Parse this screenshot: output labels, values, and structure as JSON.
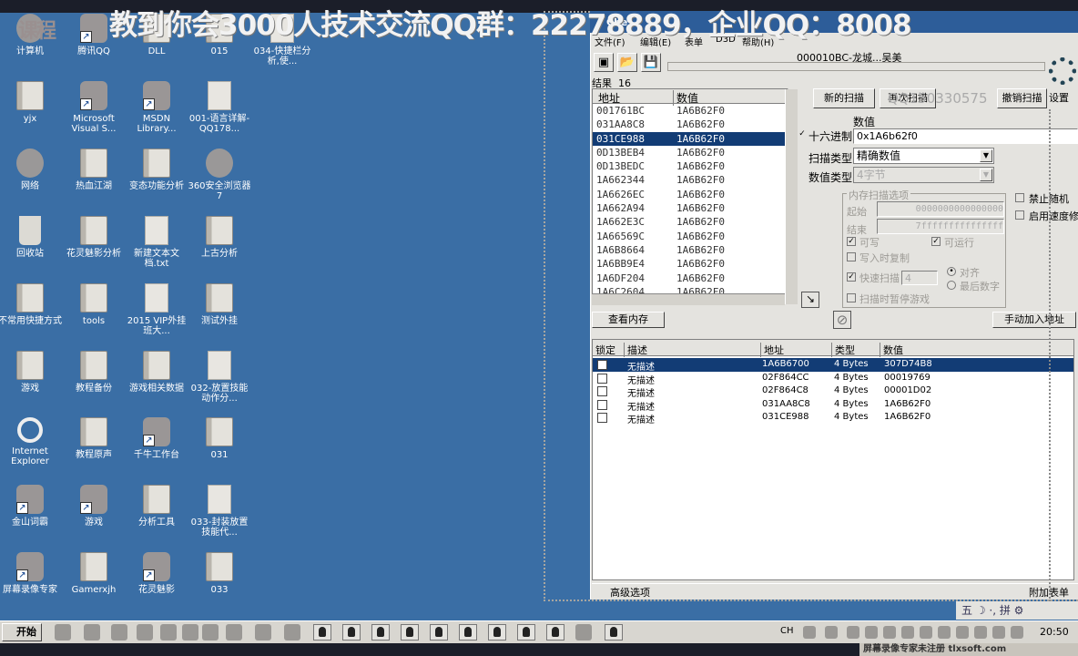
{
  "watermark": {
    "banner": "教到你会3000人技术交流QQ群：22278889，企业QQ：8008",
    "logo": "课程",
    "qq_overlay": "QQ150330575",
    "recorder": "屏幕录像专家未注册 tlxsoft.com"
  },
  "desktop": {
    "icons": [
      {
        "label": "计算机",
        "kind": "net"
      },
      {
        "label": "腾讯QQ",
        "kind": "app"
      },
      {
        "label": "DLL",
        "kind": "folder"
      },
      {
        "label": "015",
        "kind": "folder"
      },
      {
        "label": "034-快捷栏分析,使...",
        "kind": "file"
      },
      {
        "label": "yjx",
        "kind": "folder"
      },
      {
        "label": "Microsoft Visual S...",
        "kind": "app"
      },
      {
        "label": "MSDN Library...",
        "kind": "app"
      },
      {
        "label": "001-语言详解-QQ178...",
        "kind": "file"
      },
      {
        "label": "网络",
        "kind": "net"
      },
      {
        "label": "热血江湖",
        "kind": "folder"
      },
      {
        "label": "变态功能分析",
        "kind": "folder"
      },
      {
        "label": "360安全浏览器7",
        "kind": "net"
      },
      {
        "label": "回收站",
        "kind": "bin"
      },
      {
        "label": "花灵魅影分析",
        "kind": "folder"
      },
      {
        "label": "新建文本文档.txt",
        "kind": "file"
      },
      {
        "label": "上古分析",
        "kind": "folder"
      },
      {
        "label": "不常用快捷方式",
        "kind": "folder"
      },
      {
        "label": "tools",
        "kind": "folder"
      },
      {
        "label": "2015 VIP外挂班大...",
        "kind": "file"
      },
      {
        "label": "测试外挂",
        "kind": "folder"
      },
      {
        "label": "游戏",
        "kind": "folder"
      },
      {
        "label": "教程备份",
        "kind": "folder"
      },
      {
        "label": "游戏相关数据",
        "kind": "folder"
      },
      {
        "label": "032-放置技能动作分...",
        "kind": "file"
      },
      {
        "label": "Internet Explorer",
        "kind": "ie"
      },
      {
        "label": "教程原声",
        "kind": "folder"
      },
      {
        "label": "千牛工作台",
        "kind": "app"
      },
      {
        "label": "031",
        "kind": "folder"
      },
      {
        "label": "金山词霸",
        "kind": "app"
      },
      {
        "label": "游戏",
        "kind": "app"
      },
      {
        "label": "分析工具",
        "kind": "folder"
      },
      {
        "label": "033-封装放置技能代...",
        "kind": "file"
      },
      {
        "label": "屏幕录像专家",
        "kind": "app"
      },
      {
        "label": "Gamerxjh",
        "kind": "folder"
      },
      {
        "label": "花灵魅影",
        "kind": "app"
      },
      {
        "label": "033",
        "kind": "folder"
      }
    ]
  },
  "ce": {
    "title": "Che",
    "menu": [
      "文件(F)",
      "编辑(E)",
      "表单",
      "D3D",
      "帮助(H)"
    ],
    "process": "000010BC-龙城...吴美",
    "results_label": "结果",
    "results_count": "16",
    "list_headers": [
      "地址",
      "数值"
    ],
    "list_rows": [
      [
        "001761BC",
        "1A6B62F0"
      ],
      [
        "031AA8C8",
        "1A6B62F0"
      ],
      [
        "031CE988",
        "1A6B62F0"
      ],
      [
        "0D13BEB4",
        "1A6B62F0"
      ],
      [
        "0D13BEDC",
        "1A6B62F0"
      ],
      [
        "1A662344",
        "1A6B62F0"
      ],
      [
        "1A6626EC",
        "1A6B62F0"
      ],
      [
        "1A662A94",
        "1A6B62F0"
      ],
      [
        "1A662E3C",
        "1A6B62F0"
      ],
      [
        "1A66569C",
        "1A6B62F0"
      ],
      [
        "1A6B8664",
        "1A6B62F0"
      ],
      [
        "1A6BB9E4",
        "1A6B62F0"
      ],
      [
        "1A6DF204",
        "1A6B62F0"
      ],
      [
        "1A6C2604",
        "1A6B62F0"
      ]
    ],
    "selected_row": 2,
    "buttons": {
      "new_scan": "新的扫描",
      "next_scan": "再次扫描",
      "undo_scan": "撤销扫描",
      "view_memory": "查看内存",
      "add_address": "手动加入地址",
      "advanced": "高级选项",
      "table_extras": "附加表单",
      "settings": "设置"
    },
    "value_label": "数值",
    "hex_label": "十六进制",
    "value_input": "0x1A6b62f0",
    "scan_type_label": "扫描类型",
    "scan_type": "精确数值",
    "value_type_label": "数值类型",
    "value_type": "4字节",
    "mem_options": {
      "title": "内存扫描选项",
      "start_label": "起始",
      "start": "0000000000000000",
      "end_label": "结束",
      "end": "7fffffffffffffff",
      "writable": "可写",
      "executable": "可运行",
      "copy_on_write": "写入时复制",
      "fast_scan": "快速扫描",
      "fast_scan_value": "4",
      "align": "对齐",
      "last_digits": "最后数字",
      "pause": "扫描时暂停游戏"
    },
    "no_random": "禁止随机",
    "speedhack": "启用速度修",
    "table_headers": [
      "锁定",
      "描述",
      "地址",
      "类型",
      "数值"
    ],
    "table_rows": [
      [
        "无描述",
        "1A6B6700",
        "4 Bytes",
        "307D74B8"
      ],
      [
        "无描述",
        "02F864CC",
        "4 Bytes",
        "00019769"
      ],
      [
        "无描述",
        "02F864C8",
        "4 Bytes",
        "00001D02"
      ],
      [
        "无描述",
        "031AA8C8",
        "4 Bytes",
        "1A6B62F0"
      ],
      [
        "无描述",
        "031CE988",
        "4 Bytes",
        "1A6B62F0"
      ]
    ]
  },
  "ime": "五 ☽ ·, 拼 ⚙",
  "taskbar": {
    "start": "开始",
    "lang": "CH",
    "clock": "20:50"
  }
}
